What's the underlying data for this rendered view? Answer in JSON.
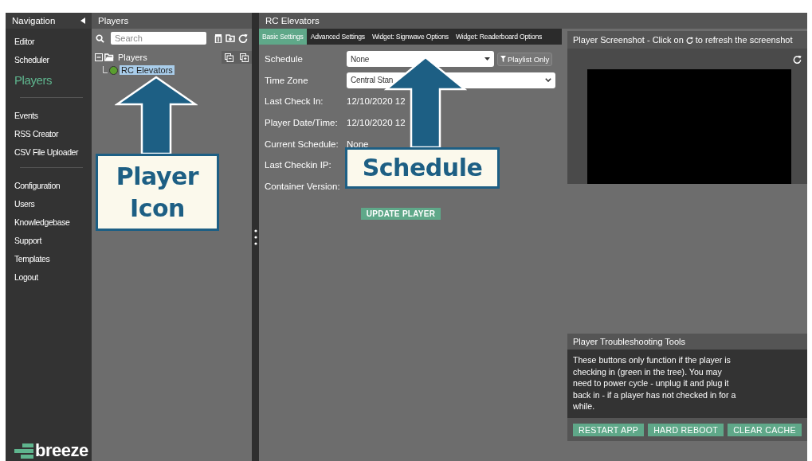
{
  "navigation": {
    "title": "Navigation",
    "groups": [
      [
        {
          "label": "Editor",
          "selected": false
        },
        {
          "label": "Scheduler",
          "selected": false
        },
        {
          "label": "Players",
          "selected": true
        }
      ],
      [
        {
          "label": "Events",
          "selected": false
        },
        {
          "label": "RSS Creator",
          "selected": false
        },
        {
          "label": "CSV File Uploader",
          "selected": false
        }
      ],
      [
        {
          "label": "Configuration",
          "selected": false
        },
        {
          "label": "Users",
          "selected": false
        },
        {
          "label": "Knowledgebase",
          "selected": false
        },
        {
          "label": "Support",
          "selected": false
        },
        {
          "label": "Templates",
          "selected": false
        },
        {
          "label": "Logout",
          "selected": false
        }
      ]
    ],
    "logo": "breeze"
  },
  "players_panel": {
    "title": "Players",
    "search": {
      "placeholder": "Search"
    },
    "tree": [
      {
        "label": "Players",
        "expanded": true,
        "children": [
          {
            "label": "RC Elevators",
            "selected": true,
            "online": true
          }
        ]
      }
    ]
  },
  "player": {
    "title": "RC Elevators",
    "tabs": [
      {
        "label": "Basic Settings",
        "selected": true
      },
      {
        "label": "Advanced Settings",
        "selected": false
      },
      {
        "label": "Widget: Signwave Options",
        "selected": false
      },
      {
        "label": "Widget: Readerboard Options",
        "selected": false
      }
    ],
    "fields": [
      {
        "label": "Schedule",
        "kind": "select",
        "value": "None"
      },
      {
        "label": "Time Zone",
        "kind": "select",
        "value": "Central Stan"
      },
      {
        "label": "Last Check In:",
        "kind": "text",
        "value": "12/10/2020 12"
      },
      {
        "label": "Player Date/Time:",
        "kind": "text",
        "value": "12/10/2020 12"
      },
      {
        "label": "Current Schedule:",
        "kind": "text",
        "value": "None"
      },
      {
        "label": "Last Checkin IP:",
        "kind": "text"
      },
      {
        "label": "Container Version:",
        "kind": "text"
      }
    ],
    "playlist_button": "Playlist Only",
    "update_button": "UPDATE PLAYER"
  },
  "screenshot": {
    "title_start": "Player Screenshot - Click on",
    "title_end": "to refresh the screenshot"
  },
  "troubleshooting": {
    "title": "Player Troubleshooting Tools",
    "description": "These buttons only function if the player is checking in (green in the tree). You may need to power cycle - unplug it and plug it back in - if a player has not checked in for a while.",
    "buttons": [
      "RESTART APP",
      "HARD REBOOT",
      "CLEAR CACHE"
    ]
  },
  "annotations": [
    {
      "text": "Player Icon"
    },
    {
      "text": "Schedule"
    }
  ]
}
